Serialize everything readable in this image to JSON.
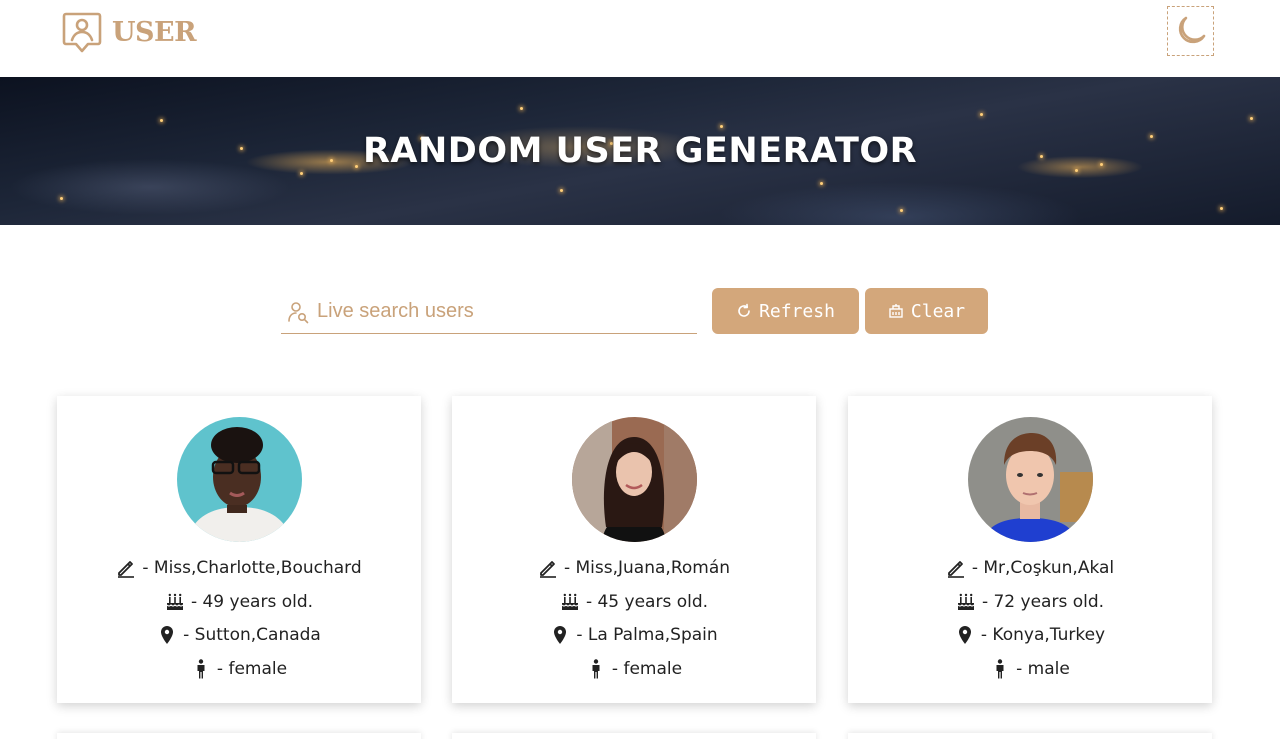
{
  "header": {
    "brand": "USER",
    "theme_toggle_icon": "moon-icon"
  },
  "hero": {
    "title": "RANDOM USER GENERATOR"
  },
  "search": {
    "placeholder": "Live search users",
    "icon": "user-search-icon"
  },
  "buttons": {
    "refresh_label": "Refresh",
    "clear_label": "Clear"
  },
  "colors": {
    "accent": "#c9a27a",
    "button_bg": "#d3a77b"
  },
  "users": [
    {
      "name": "- Miss,Charlotte,Bouchard",
      "age": "- 49 years old.",
      "location": "- Sutton,Canada",
      "gender": "- female"
    },
    {
      "name": "- Miss,Juana,Román",
      "age": "- 45 years old.",
      "location": "- La Palma,Spain",
      "gender": "- female"
    },
    {
      "name": "- Mr,Coşkun,Akal",
      "age": "- 72 years old.",
      "location": "- Konya,Turkey",
      "gender": "- male"
    }
  ]
}
